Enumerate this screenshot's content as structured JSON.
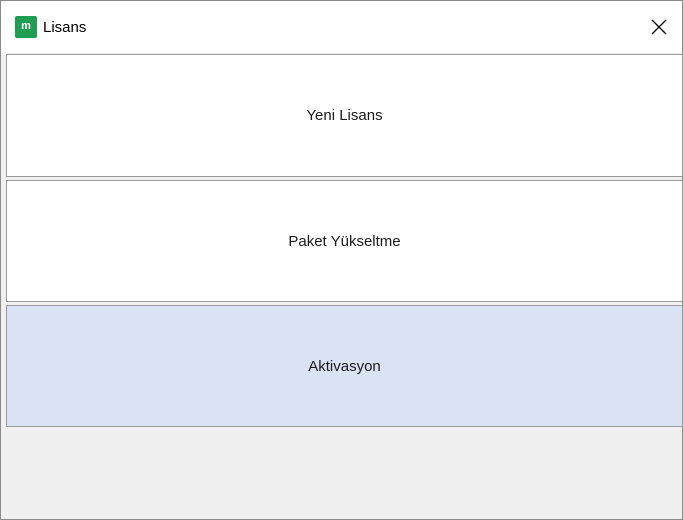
{
  "window": {
    "title": "Lisans",
    "app_icon_glyph": "m",
    "app_icon_color": "#1e9e50",
    "close_icon": "close-icon"
  },
  "options": [
    {
      "label": "Yeni Lisans",
      "selected": false
    },
    {
      "label": "Paket Yükseltme",
      "selected": false
    },
    {
      "label": "Aktivasyon",
      "selected": true
    }
  ],
  "colors": {
    "selected_background": "#dae3f5",
    "option_background": "#ffffff",
    "window_background": "#f0f0f0"
  }
}
